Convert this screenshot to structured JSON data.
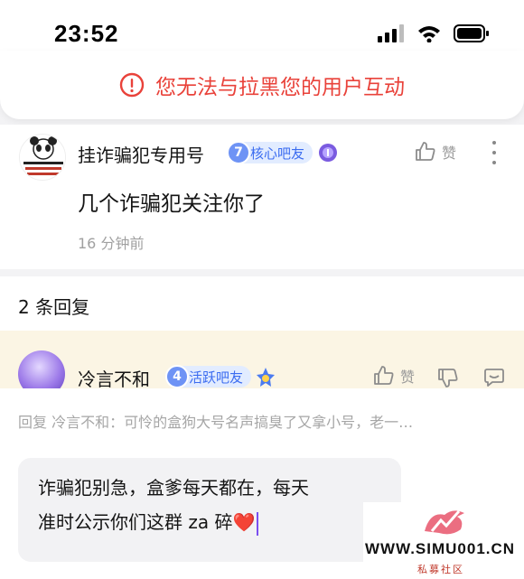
{
  "status_bar": {
    "time": "23:52"
  },
  "banner": {
    "text": "您无法与拉黑您的用户互动",
    "color": "#e9423a"
  },
  "post": {
    "username": "挂诈骗犯专用号",
    "level": "7",
    "badge": "核心吧友",
    "like_label": "赞",
    "content": "几个诈骗犯关注你了",
    "time": "16 分钟前"
  },
  "replies": {
    "count_label": "2 条回复"
  },
  "reply": {
    "username": "冷言不和",
    "level": "4",
    "badge": "活跃吧友",
    "like_label": "赞"
  },
  "reply_input": {
    "quote": "回复 冷言不和：可怜的盒狗大号名声搞臭了又拿小号，老一…",
    "line1": "诈骗犯别急，盒爹每天都在，每天",
    "line2": "准时公示你们这群 za 碎",
    "emoji": "❤️"
  },
  "watermark": {
    "text": "WWW.SIMU001.CN",
    "sub": "私募社区"
  },
  "icons": [
    "signal-icon",
    "wifi-icon",
    "battery-icon",
    "alert-circle-icon",
    "thumb-up-icon",
    "more-icon",
    "thumb-down-icon",
    "comment-icon",
    "medal-icon"
  ],
  "accent_color": "#3b6cf0"
}
